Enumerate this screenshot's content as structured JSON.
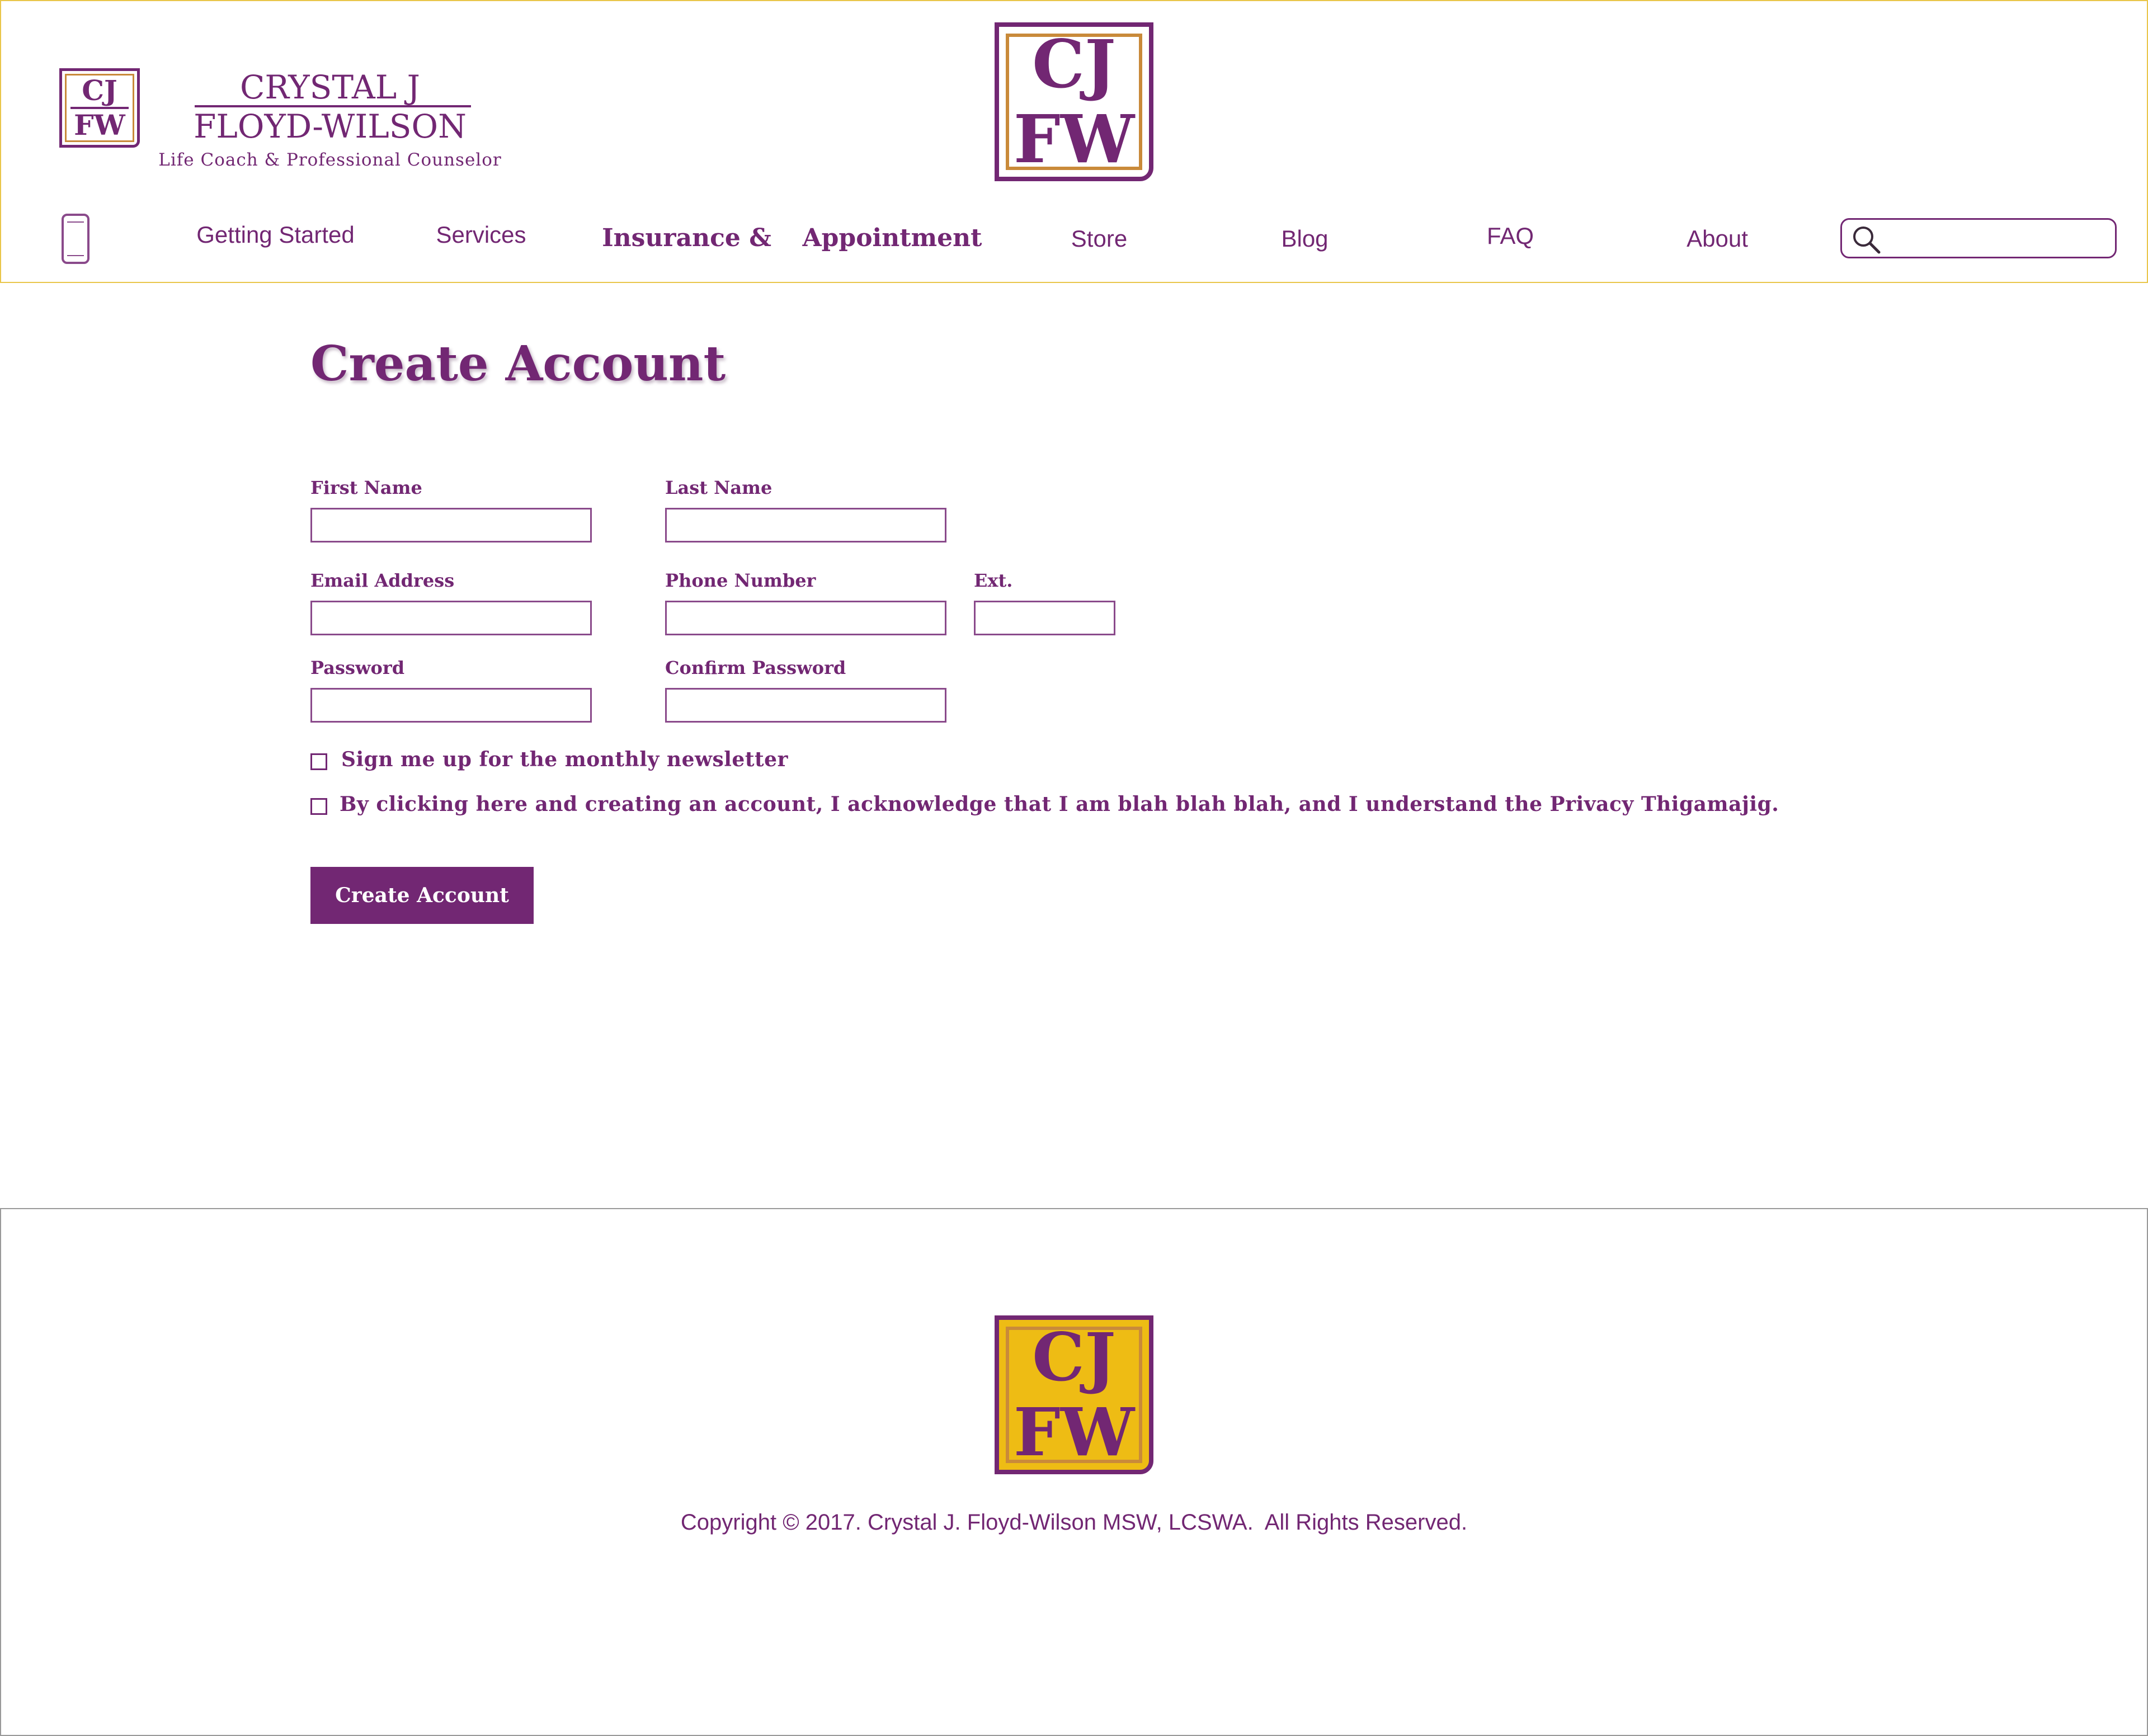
{
  "brand": {
    "logo_top": "CJ",
    "logo_bottom": "FW",
    "name_line1": "CRYSTAL J",
    "name_line2": "FLOYD-WILSON",
    "tagline": "Life Coach & Professional Counselor"
  },
  "nav": {
    "items": [
      {
        "label": "Getting Started"
      },
      {
        "label": "Services"
      },
      {
        "label": "Insurance &"
      },
      {
        "label": "Appointment"
      },
      {
        "label": "Store"
      },
      {
        "label": "Blog"
      },
      {
        "label": "FAQ"
      },
      {
        "label": "About"
      }
    ],
    "search": {
      "value": "",
      "placeholder": ""
    },
    "icons": {
      "mobile": "phone-icon",
      "search": "search-icon"
    }
  },
  "form": {
    "title": "Create Account",
    "first_name": {
      "label": "First Name",
      "value": ""
    },
    "last_name": {
      "label": "Last Name",
      "value": ""
    },
    "email": {
      "label": "Email Address",
      "value": ""
    },
    "phone": {
      "label": "Phone Number",
      "value": ""
    },
    "ext": {
      "label": "Ext.",
      "value": ""
    },
    "password": {
      "label": "Password",
      "value": ""
    },
    "confirm_password": {
      "label": "Confirm Password",
      "value": ""
    },
    "newsletter": {
      "label": "Sign me up for the monthly newsletter",
      "checked": false
    },
    "acknowledge": {
      "label": "By clicking here and creating an account, I acknowledge that I am blah blah blah, and I understand the Privacy Thigamajig.",
      "checked": false
    },
    "submit_label": "Create Account"
  },
  "footer": {
    "copyright": "Copyright © 2017. Crystal J. Floyd-Wilson MSW, LCSWA.  All Rights Reserved."
  },
  "colors": {
    "brand_purple": "#722773",
    "brand_gold": "#eebc14",
    "header_border": "#e9c64a",
    "footer_border": "#999999"
  }
}
